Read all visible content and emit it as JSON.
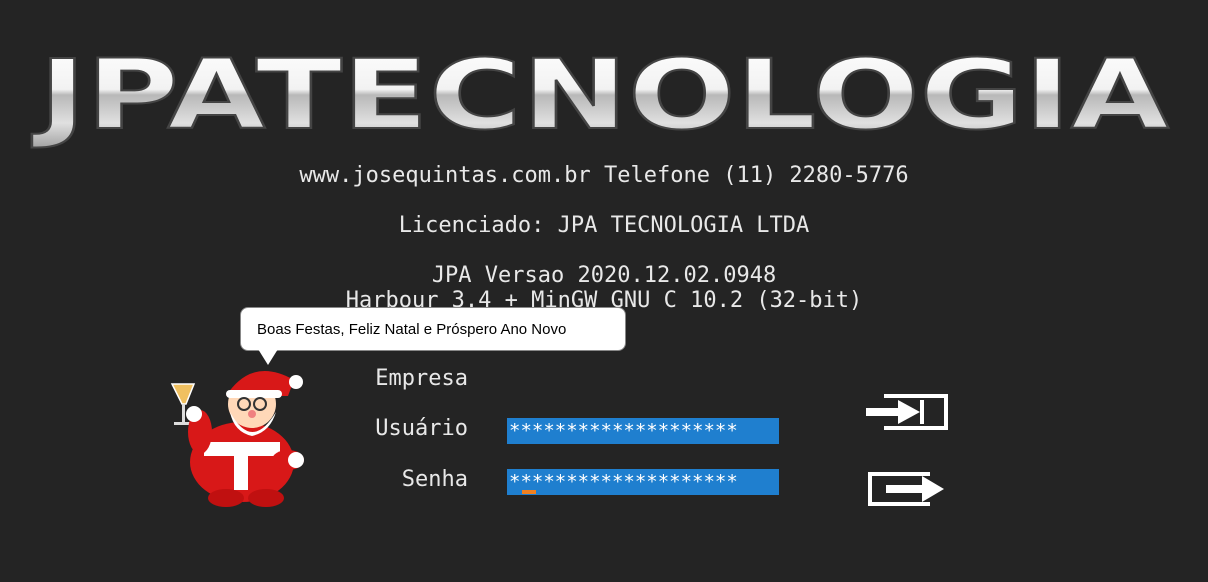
{
  "brand": {
    "logo_text": "JPATECNOLOGIA"
  },
  "header": {
    "contact_line": "www.josequintas.com.br Telefone (11) 2280-5776",
    "license_line": "Licenciado: JPA TECNOLOGIA LTDA",
    "version_line": "JPA Versao 2020.12.02.0948",
    "compiler_line": "Harbour 3.4 + MinGW GNU C 10.2 (32-bit)"
  },
  "greeting": {
    "message": "Boas Festas, Feliz Natal e Próspero Ano Novo"
  },
  "login": {
    "empresa_label": "Empresa",
    "usuario_label": "Usuário",
    "senha_label": "Senha",
    "usuario_value": "********************",
    "senha_value": "********************"
  },
  "icons": {
    "login": "login-arrow-icon",
    "exit": "exit-arrow-icon",
    "mascot": "santa-claus-icon"
  },
  "colors": {
    "background": "#242424",
    "field_background": "#1f7fcf",
    "cursor": "#f08020",
    "text": "#e8e8e8"
  }
}
